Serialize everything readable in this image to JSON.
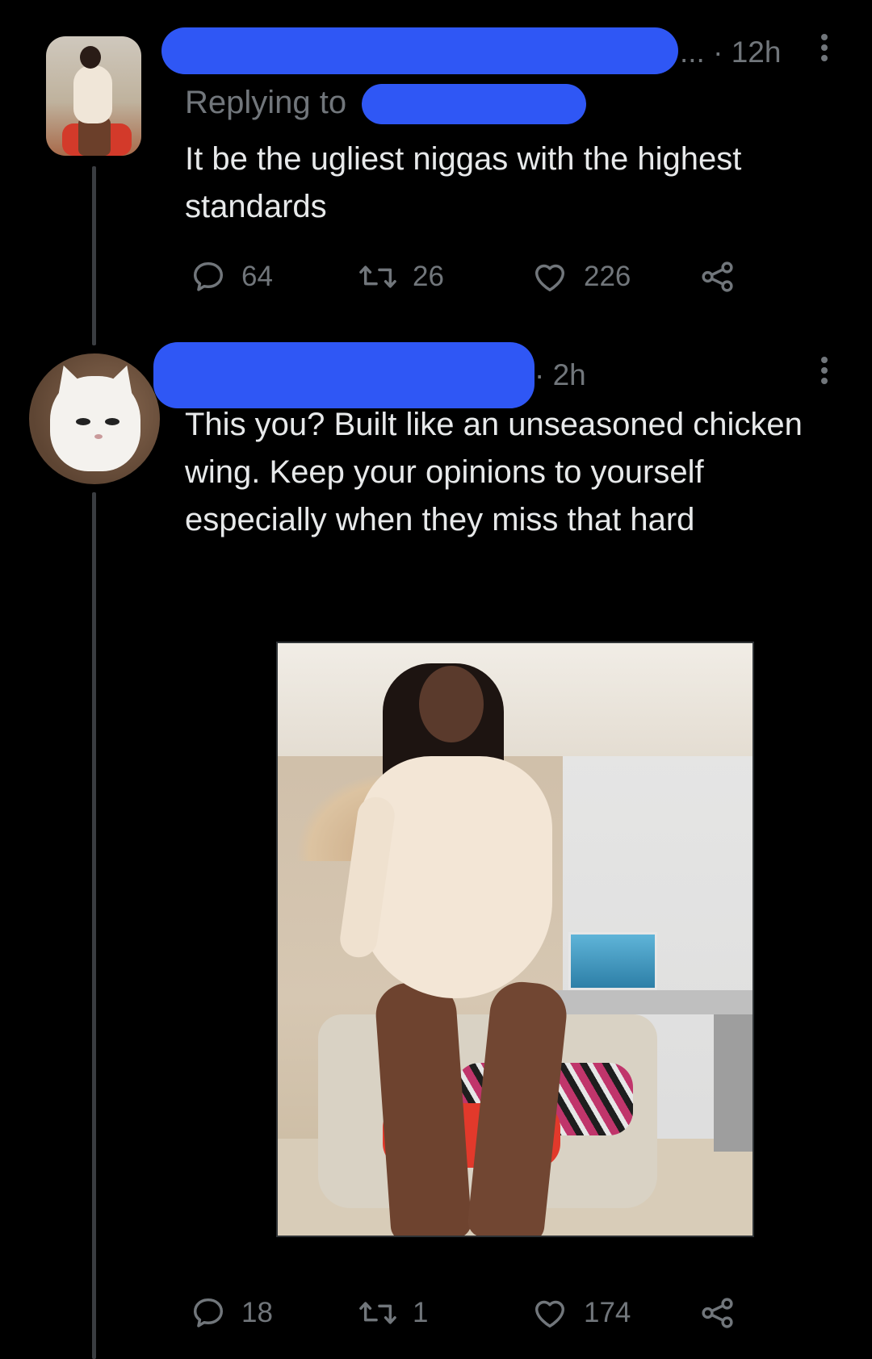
{
  "tweets": [
    {
      "time": "· 12h",
      "name_truncation": "...",
      "replying_to_label": "Replying to",
      "text": "It be the ugliest niggas with the highest standards",
      "actions": {
        "replies": "64",
        "retweets": "26",
        "likes": "226"
      }
    },
    {
      "time": "· 2h",
      "text": "This you? Built like an unseasoned chicken wing. Keep your opinions to yourself especially when they miss that hard",
      "actions": {
        "replies": "18",
        "retweets": "1",
        "likes": "174"
      }
    }
  ],
  "icons": {
    "reply": "reply-icon",
    "retweet": "retweet-icon",
    "like": "heart-icon",
    "share": "share-icon",
    "more": "more-options-icon"
  },
  "colors": {
    "background": "#000000",
    "text_primary": "#e7e9ea",
    "text_secondary": "#71767b",
    "redaction": "#2f57f5",
    "thread_line": "#3a3d41"
  }
}
